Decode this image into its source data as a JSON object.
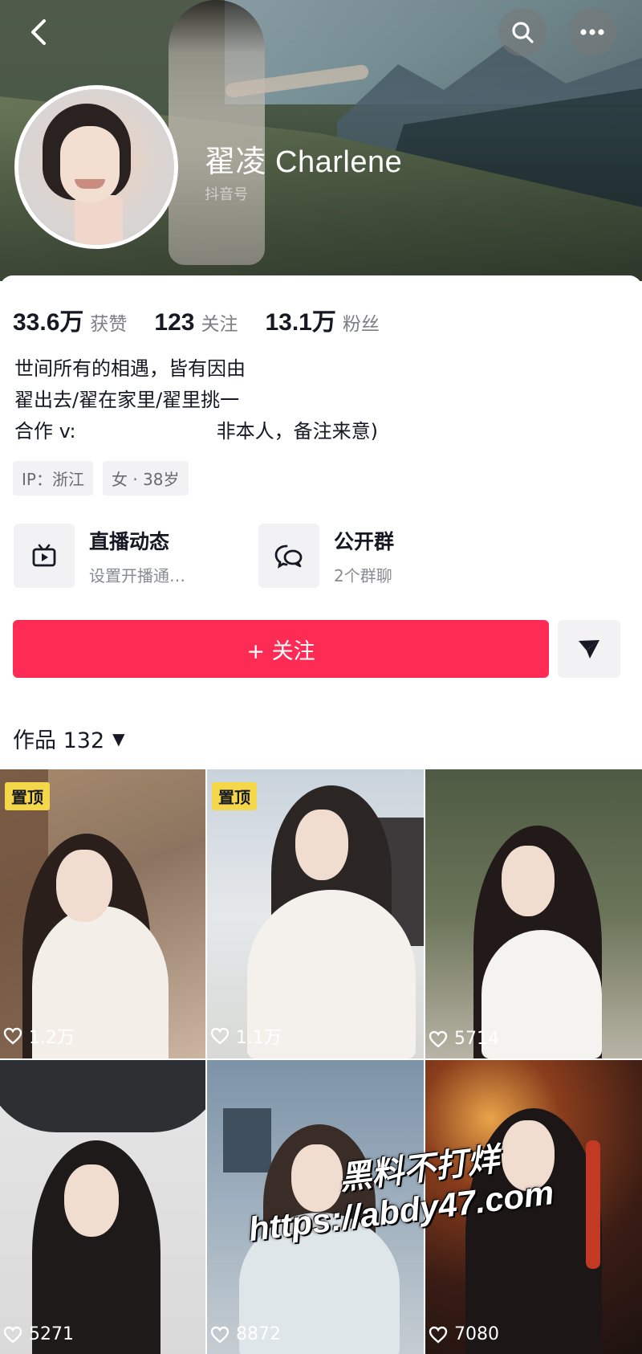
{
  "profile": {
    "display_name": "翟凌 Charlene",
    "id_label": "抖音号"
  },
  "stats": [
    {
      "value": "33.6万",
      "label": "获赞"
    },
    {
      "value": "123",
      "label": "关注"
    },
    {
      "value": "13.1万",
      "label": "粉丝"
    }
  ],
  "bio": {
    "line1": "世间所有的相遇，皆有因由",
    "line2": "翟出去/翟在家里/翟里挑一",
    "line3_prefix": "合作 v:",
    "line3_suffix": "非本人，备注来意)"
  },
  "tags": [
    "IP：浙江",
    "女 · 38岁"
  ],
  "features": {
    "live": {
      "title": "直播动态",
      "subtitle": "设置开播通…",
      "icon": "tv-icon"
    },
    "group": {
      "title": "公开群",
      "subtitle": "2个群聊",
      "icon": "chat-bubbles-icon"
    }
  },
  "actions": {
    "follow_label": "+ 关注",
    "share_icon": "send-icon"
  },
  "works": {
    "label": "作品 132",
    "caret": "▼"
  },
  "grid": [
    {
      "likes": "1.2万",
      "pinned": "置顶"
    },
    {
      "likes": "1.1万",
      "pinned": "置顶"
    },
    {
      "likes": "5714",
      "pinned": ""
    },
    {
      "likes": "5271",
      "pinned": ""
    },
    {
      "likes": "8872",
      "pinned": ""
    },
    {
      "likes": "7080",
      "pinned": ""
    }
  ],
  "watermark": {
    "line1": "黑料不打烊",
    "line2": "https://abdy47.com"
  },
  "colors": {
    "accent": "#fe2c55",
    "pin": "#f5d74a",
    "text": "#161823",
    "muted": "#7d7e85"
  }
}
